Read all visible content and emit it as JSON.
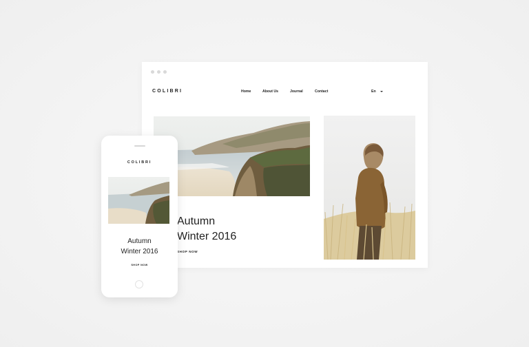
{
  "desktop": {
    "brand": "COLIBRI",
    "nav": [
      "Home",
      "About Us",
      "Journal",
      "Contact"
    ],
    "language": "En",
    "headline_line1": "Autumn",
    "headline_line2": "Winter 2016",
    "cta": "SHOP NOW"
  },
  "mobile": {
    "brand": "COLIBRI",
    "headline_line1": "Autumn",
    "headline_line2": "Winter 2016",
    "cta": "SHOP NOW"
  },
  "images": {
    "hero": "coastal-cliffs-photo",
    "side": "person-in-field-photo"
  },
  "colors": {
    "background": "#f3f3f3",
    "text": "#222222",
    "sand": "#e8ddc8",
    "sea": "#c9d4d6",
    "cliff": "#7d6a4a",
    "grass": "#d8c79a",
    "coat": "#8a6435"
  }
}
